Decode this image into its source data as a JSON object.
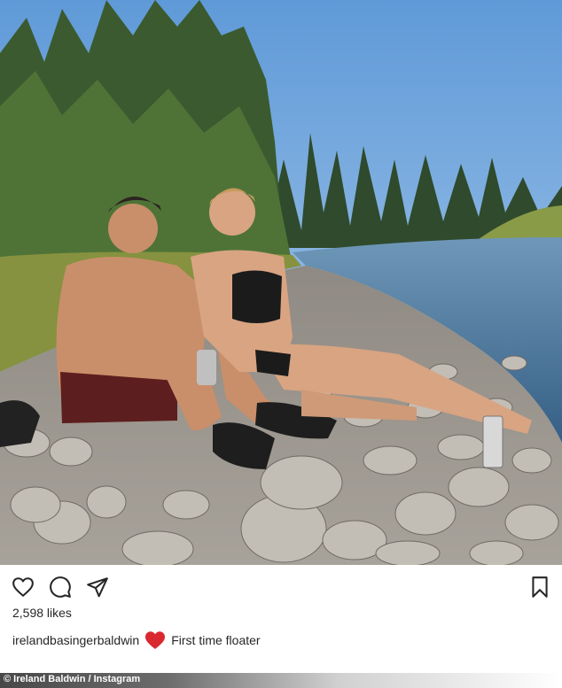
{
  "post": {
    "image_alt": "",
    "likes_text": "2,598 likes",
    "username": "irelandbasingerbaldwin",
    "caption_emoji": "red-heart",
    "caption_text": "First time floater"
  },
  "actions": {
    "like_icon": "heart-outline-icon",
    "comment_icon": "comment-bubble-icon",
    "share_icon": "paper-plane-icon",
    "save_icon": "bookmark-icon"
  },
  "credit": {
    "text": "© Ireland Baldwin / Instagram"
  },
  "colors": {
    "text": "#262626",
    "heart_red": "#d9282f",
    "sky": "#8fb6e0"
  }
}
